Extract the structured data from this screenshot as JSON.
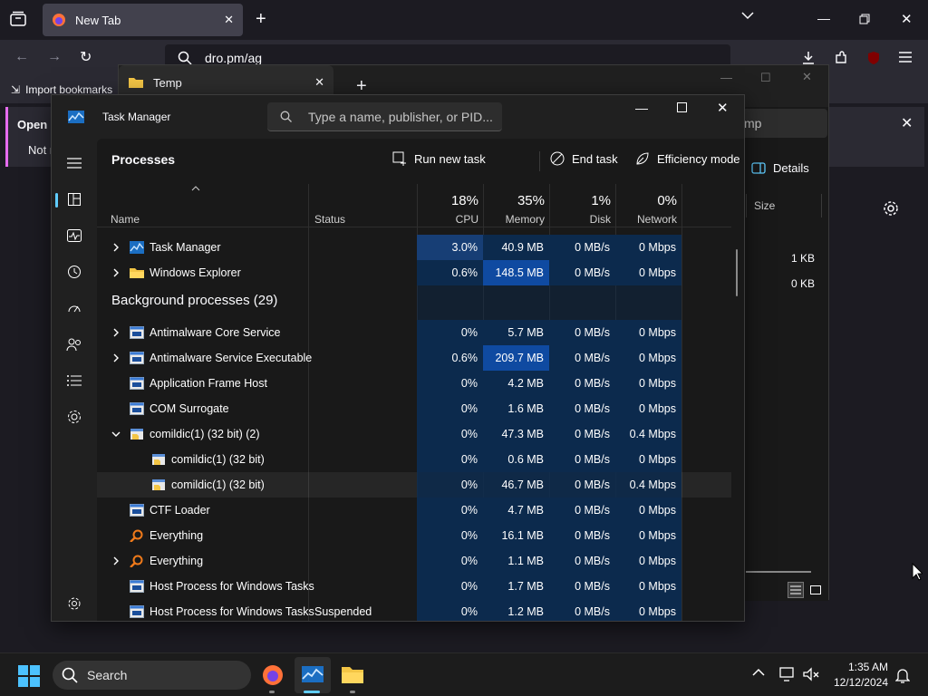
{
  "firefox": {
    "tab_title": "New Tab",
    "url_text": "dro.pm/ag",
    "bookmarks_label": "Import bookmarks",
    "notice_line1": "Open F",
    "notice_line2": "Not n"
  },
  "explorer": {
    "tab_title": "Temp",
    "search_partial": "mp",
    "details_label": "Details",
    "size_header": "Size",
    "sizes": [
      "1 KB",
      "0 KB"
    ]
  },
  "task_manager": {
    "title": "Task Manager",
    "search_placeholder": "Type a name, publisher, or PID...",
    "page_title": "Processes",
    "commands": {
      "run_new_task": "Run new task",
      "end_task": "End task",
      "efficiency_mode": "Efficiency mode"
    },
    "columns": {
      "name": "Name",
      "status": "Status",
      "cpu": {
        "pct": "18%",
        "label": "CPU"
      },
      "memory": {
        "pct": "35%",
        "label": "Memory"
      },
      "disk": {
        "pct": "1%",
        "label": "Disk"
      },
      "network": {
        "pct": "0%",
        "label": "Network"
      }
    },
    "group_background": "Background processes (29)",
    "apps": [
      {
        "name": "Task Manager",
        "status": "",
        "cpu": "3.0%",
        "memory": "40.9 MB",
        "disk": "0 MB/s",
        "network": "0 Mbps",
        "icon": "taskmgr-icon",
        "expander": "collapsed"
      },
      {
        "name": "Windows Explorer",
        "status": "",
        "cpu": "0.6%",
        "memory": "148.5 MB",
        "disk": "0 MB/s",
        "network": "0 Mbps",
        "icon": "folder-icon",
        "expander": "collapsed"
      }
    ],
    "background": [
      {
        "name": "Antimalware Core Service",
        "status": "",
        "cpu": "0%",
        "memory": "5.7 MB",
        "disk": "0 MB/s",
        "network": "0 Mbps",
        "icon": "window-app-icon",
        "expander": "collapsed",
        "indent": 0
      },
      {
        "name": "Antimalware Service Executable",
        "status": "",
        "cpu": "0.6%",
        "memory": "209.7 MB",
        "disk": "0 MB/s",
        "network": "0 Mbps",
        "icon": "window-app-icon",
        "expander": "collapsed",
        "indent": 0
      },
      {
        "name": "Application Frame Host",
        "status": "",
        "cpu": "0%",
        "memory": "4.2 MB",
        "disk": "0 MB/s",
        "network": "0 Mbps",
        "icon": "window-app-icon",
        "expander": "none",
        "indent": 0
      },
      {
        "name": "COM Surrogate",
        "status": "",
        "cpu": "0%",
        "memory": "1.6 MB",
        "disk": "0 MB/s",
        "network": "0 Mbps",
        "icon": "window-app-icon",
        "expander": "none",
        "indent": 0
      },
      {
        "name": "comildic(1) (32 bit) (2)",
        "status": "",
        "cpu": "0%",
        "memory": "47.3 MB",
        "disk": "0 MB/s",
        "network": "0.4 Mbps",
        "icon": "exe-icon",
        "expander": "expanded",
        "indent": 0
      },
      {
        "name": "comildic(1) (32 bit)",
        "status": "",
        "cpu": "0%",
        "memory": "0.6 MB",
        "disk": "0 MB/s",
        "network": "0 Mbps",
        "icon": "exe-icon",
        "expander": "none",
        "indent": 1
      },
      {
        "name": "comildic(1) (32 bit)",
        "status": "",
        "cpu": "0%",
        "memory": "46.7 MB",
        "disk": "0 MB/s",
        "network": "0.4 Mbps",
        "icon": "exe-icon",
        "expander": "none",
        "indent": 1,
        "hover": true
      },
      {
        "name": "CTF Loader",
        "status": "",
        "cpu": "0%",
        "memory": "4.7 MB",
        "disk": "0 MB/s",
        "network": "0 Mbps",
        "icon": "window-app-icon",
        "expander": "none",
        "indent": 0
      },
      {
        "name": "Everything",
        "status": "",
        "cpu": "0%",
        "memory": "16.1 MB",
        "disk": "0 MB/s",
        "network": "0 Mbps",
        "icon": "everything-icon",
        "expander": "none",
        "indent": 0
      },
      {
        "name": "Everything",
        "status": "",
        "cpu": "0%",
        "memory": "1.1 MB",
        "disk": "0 MB/s",
        "network": "0 Mbps",
        "icon": "everything-icon",
        "expander": "collapsed",
        "indent": 0
      },
      {
        "name": "Host Process for Windows Tasks",
        "status": "",
        "cpu": "0%",
        "memory": "1.7 MB",
        "disk": "0 MB/s",
        "network": "0 Mbps",
        "icon": "window-app-icon",
        "expander": "none",
        "indent": 0
      },
      {
        "name": "Host Process for Windows Tasks",
        "status": "Suspended",
        "cpu": "0%",
        "memory": "1.2 MB",
        "disk": "0 MB/s",
        "network": "0 Mbps",
        "icon": "window-app-icon",
        "expander": "none",
        "indent": 0
      }
    ]
  },
  "taskbar": {
    "search_label": "Search",
    "time": "1:35 AM",
    "date": "12/12/2024"
  },
  "colors": {
    "accent": "#60cdff",
    "heat_low": "#0c2a4d",
    "heat_mid": "#173e75",
    "heat_high": "#0f4aa1"
  }
}
